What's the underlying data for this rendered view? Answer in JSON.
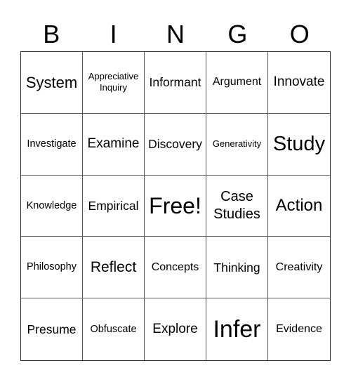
{
  "header": {
    "letters": [
      "B",
      "I",
      "N",
      "G",
      "O"
    ]
  },
  "card": {
    "rows": [
      [
        "System",
        "Appreciative Inquiry",
        "Informant",
        "Argument",
        "Innovate"
      ],
      [
        "Investigate",
        "Examine",
        "Discovery",
        "Generativity",
        "Study"
      ],
      [
        "Knowledge",
        "Empirical",
        "Free!",
        "Case Studies",
        "Action"
      ],
      [
        "Philosophy",
        "Reflect",
        "Concepts",
        "Thinking",
        "Creativity"
      ],
      [
        "Presume",
        "Obfuscate",
        "Explore",
        "Infer",
        "Evidence"
      ]
    ],
    "free_space": "Free!"
  }
}
